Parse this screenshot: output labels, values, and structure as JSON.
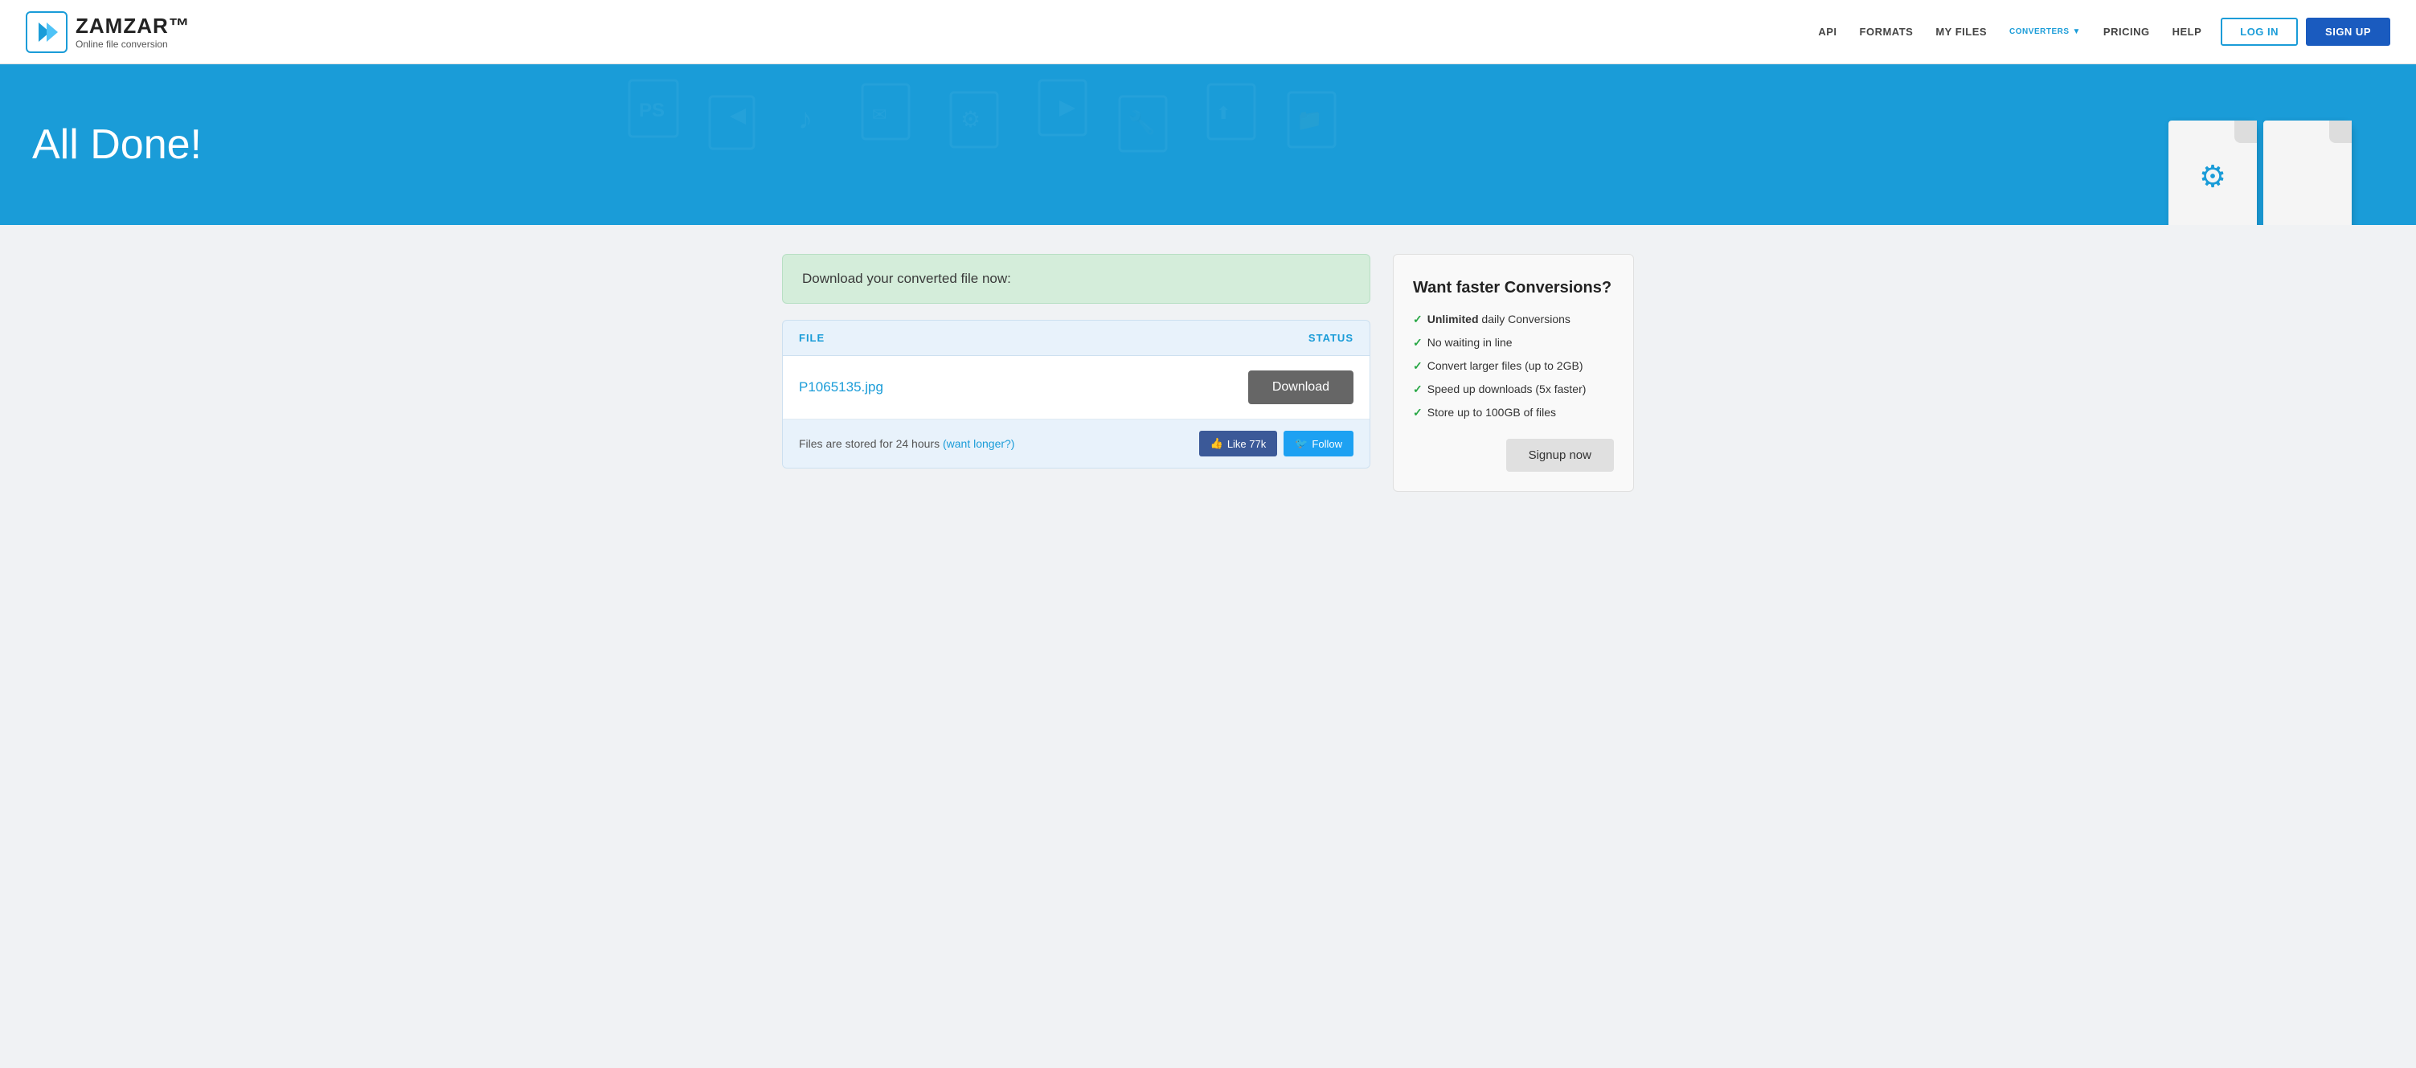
{
  "header": {
    "logo_brand": "ZAMZAR™",
    "logo_tagline": "Online file conversion",
    "nav": {
      "api": "API",
      "formats": "FORMATS",
      "my_files": "MY FILES",
      "converters": "CONVERTERS",
      "pricing": "PRICING",
      "help": "HELP"
    },
    "login_label": "LOG IN",
    "signup_label": "SIGN UP"
  },
  "hero": {
    "title": "All Done!"
  },
  "main": {
    "success_banner": "Download your converted file now:",
    "table": {
      "col_file": "FILE",
      "col_status": "STATUS",
      "rows": [
        {
          "filename": "P1065135.jpg",
          "download_label": "Download"
        }
      ],
      "footer_note": "Files are stored for 24 hours ",
      "footer_link": "(want longer?)",
      "facebook_label": "Like 77k",
      "twitter_label": "Follow"
    }
  },
  "sidebar": {
    "title": "Want faster Conversions?",
    "features": [
      {
        "bold": "Unlimited",
        "rest": " daily Conversions"
      },
      {
        "bold": "",
        "rest": "No waiting in line"
      },
      {
        "bold": "",
        "rest": "Convert larger files (up to 2GB)"
      },
      {
        "bold": "",
        "rest": "Speed up downloads (5x faster)"
      },
      {
        "bold": "",
        "rest": "Store up to 100GB of files"
      }
    ],
    "signup_label": "Signup now"
  }
}
